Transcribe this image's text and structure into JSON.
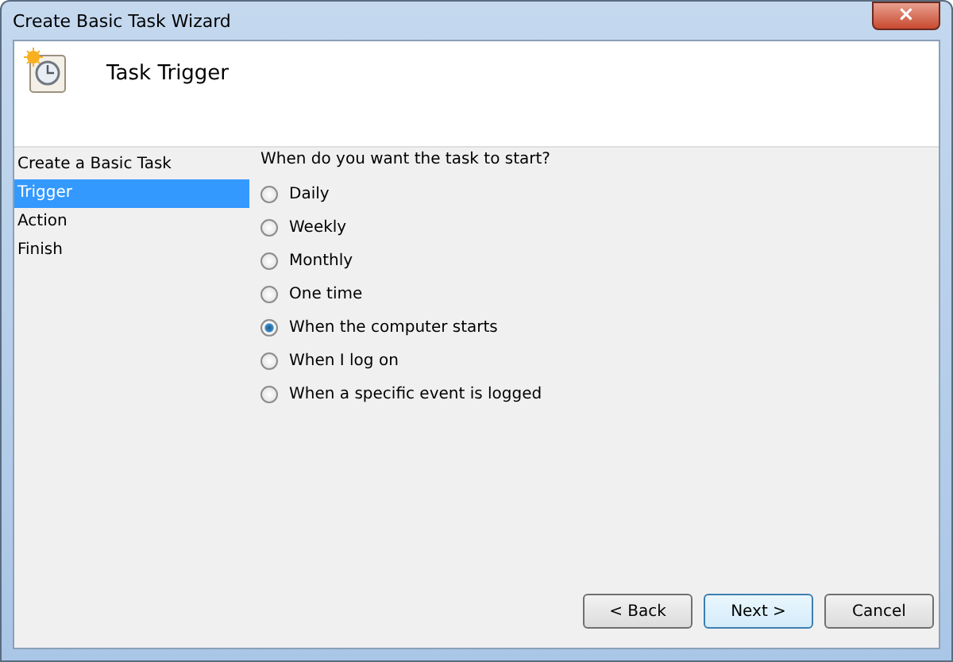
{
  "window": {
    "title": "Create Basic Task Wizard",
    "close": "×"
  },
  "header": {
    "title": "Task Trigger"
  },
  "sidebar": {
    "items": [
      {
        "label": "Create a Basic Task",
        "selected": false
      },
      {
        "label": "Trigger",
        "selected": true
      },
      {
        "label": "Action",
        "selected": false
      },
      {
        "label": "Finish",
        "selected": false
      }
    ]
  },
  "question": "When do you want the task to start?",
  "options": [
    {
      "label": "Daily",
      "selected": false
    },
    {
      "label": "Weekly",
      "selected": false
    },
    {
      "label": "Monthly",
      "selected": false
    },
    {
      "label": "One time",
      "selected": false
    },
    {
      "label": "When the computer starts",
      "selected": true
    },
    {
      "label": "When I log on",
      "selected": false
    },
    {
      "label": "When a specific event is logged",
      "selected": false
    }
  ],
  "buttons": [
    {
      "label": "< Back",
      "default": false
    },
    {
      "label": "Next >",
      "default": true
    },
    {
      "label": "Cancel",
      "default": false
    }
  ]
}
